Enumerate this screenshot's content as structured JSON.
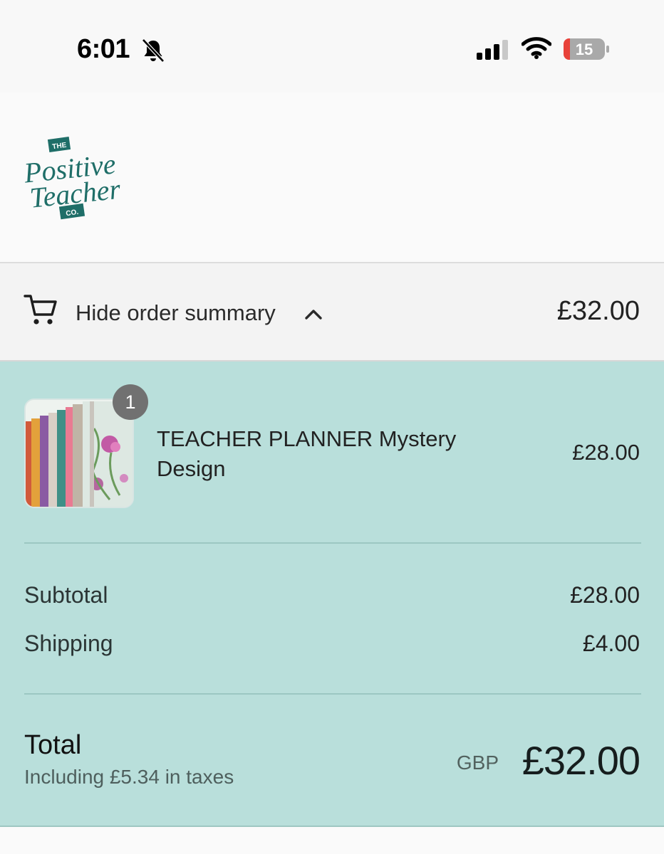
{
  "status_bar": {
    "time": "6:01",
    "battery_level": "15",
    "icons": [
      "bell-slash-icon",
      "cellular-signal-icon",
      "wifi-icon",
      "battery-icon"
    ]
  },
  "brand": {
    "logo_top": "THE",
    "logo_line1": "Positive",
    "logo_line2": "Teacher",
    "logo_bottom": "CO.",
    "color": "#1f6e68"
  },
  "summary_toggle": {
    "label": "Hide order summary",
    "total": "£32.00",
    "icons": [
      "cart-icon",
      "chevron-up-icon"
    ]
  },
  "order": {
    "items": [
      {
        "quantity": "1",
        "name": "TEACHER PLANNER Mystery Design",
        "price": "£28.00"
      }
    ],
    "subtotal_label": "Subtotal",
    "subtotal": "£28.00",
    "shipping_label": "Shipping",
    "shipping": "£4.00",
    "total_label": "Total",
    "tax_note": "Including £5.34 in taxes",
    "currency": "GBP",
    "total": "£32.00"
  },
  "colors": {
    "panel_bg": "#b9dfdb",
    "toggle_bg": "#f3f3f3",
    "badge_bg": "#717171"
  }
}
